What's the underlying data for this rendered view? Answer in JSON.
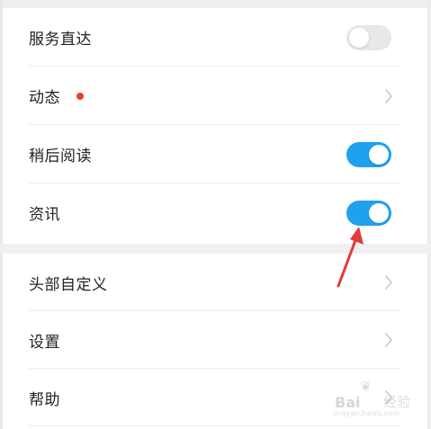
{
  "settings": {
    "group1": [
      {
        "label": "服务直达",
        "control": "toggle",
        "state": "off"
      },
      {
        "label": "动态",
        "control": "chevron",
        "badge": "red-dot"
      },
      {
        "label": "稍后阅读",
        "control": "toggle",
        "state": "on"
      },
      {
        "label": "资讯",
        "control": "toggle",
        "state": "on"
      }
    ],
    "group2": [
      {
        "label": "头部自定义",
        "control": "chevron"
      },
      {
        "label": "设置",
        "control": "chevron"
      },
      {
        "label": "帮助",
        "control": "chevron"
      }
    ]
  },
  "colors": {
    "toggle_on": "#1ea1ee",
    "toggle_off": "#e8e8e8",
    "badge": "#ee3a33",
    "annotation_arrow": "#e23b3b"
  },
  "watermark": {
    "brand": "Bai",
    "brand_suffix": "经验",
    "url": "jingyan.baidu.com"
  }
}
